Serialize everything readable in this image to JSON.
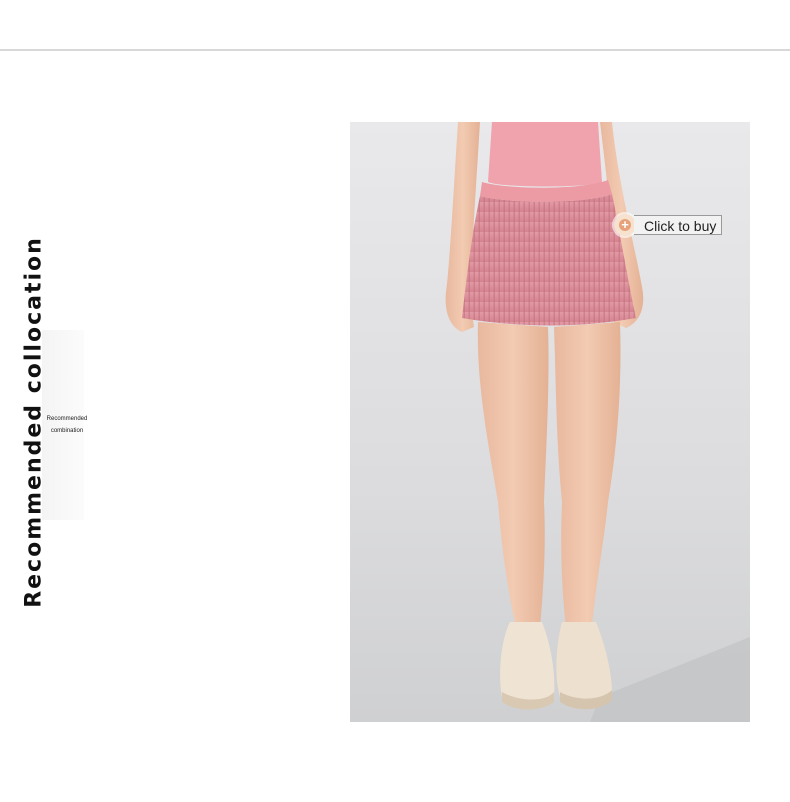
{
  "section": {
    "title": "Recommended collocation",
    "subtitle_line1": "Recommended",
    "subtitle_line2": "combination"
  },
  "product_image": {
    "alt": "",
    "buy_tag": {
      "icon": "plus-icon",
      "label": "Click to buy"
    }
  },
  "colors": {
    "accent": "#e6a27a",
    "skirt": "#dc8f9a",
    "background": "#ffffff",
    "photo_background": "#e3e3e5"
  }
}
